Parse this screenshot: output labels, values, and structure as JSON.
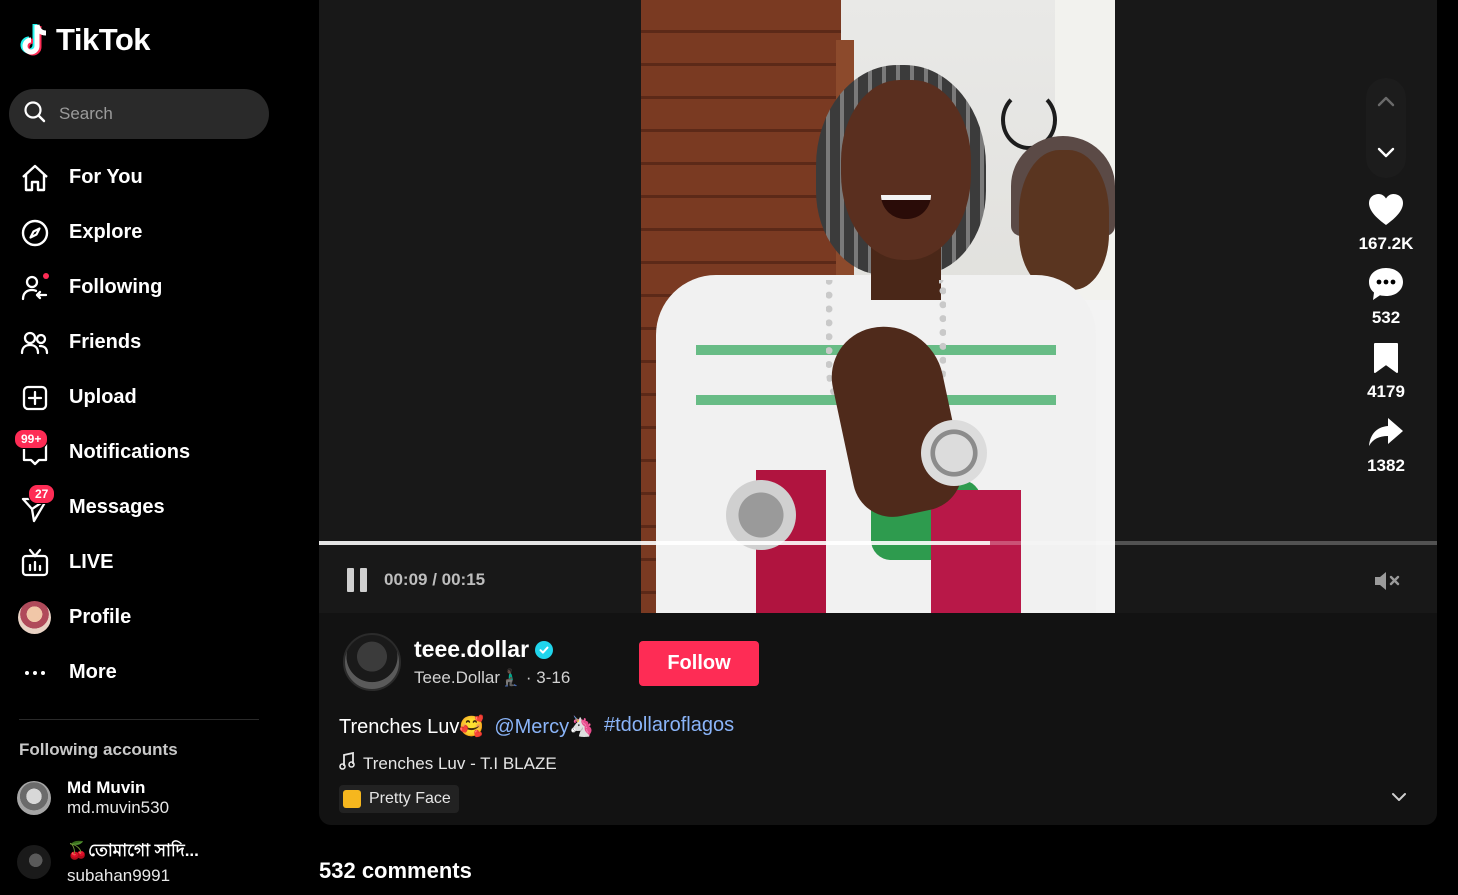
{
  "app": {
    "logo_text": "TikTok"
  },
  "search": {
    "placeholder": "Search"
  },
  "nav": {
    "items": [
      {
        "label": "For You",
        "icon": "home-icon"
      },
      {
        "label": "Explore",
        "icon": "compass-icon"
      },
      {
        "label": "Following",
        "icon": "following-icon"
      },
      {
        "label": "Friends",
        "icon": "friends-icon"
      },
      {
        "label": "Upload",
        "icon": "upload-icon"
      },
      {
        "label": "Notifications",
        "icon": "inbox-icon",
        "badge": "99+"
      },
      {
        "label": "Messages",
        "icon": "send-icon",
        "badge": "27"
      },
      {
        "label": "LIVE",
        "icon": "live-icon"
      },
      {
        "label": "Profile",
        "icon": "avatar"
      },
      {
        "label": "More",
        "icon": "more-icon"
      }
    ]
  },
  "following_accounts": {
    "title": "Following accounts",
    "accounts": [
      {
        "name": "Md Muvin",
        "username": "md.muvin530"
      },
      {
        "name": "🍒তোমাগো সাদি...",
        "username": "subahan9991"
      }
    ]
  },
  "player": {
    "time": "00:09 / 00:15",
    "progress_fraction": 0.6,
    "muted": true
  },
  "actions": {
    "likes": "167.2K",
    "comments": "532",
    "saves": "4179",
    "shares": "1382"
  },
  "video": {
    "creator_handle": "teee.dollar",
    "creator_sub": "Teee.Dollar🧎🏿‍♂️ · 3-16",
    "follow_label": "Follow",
    "caption_text": "Trenches Luv🥰",
    "caption_mention": "@Mercy🦄",
    "caption_hashtag": "#tdollaroflagos",
    "music": "Trenches Luv - T.I BLAZE",
    "effect": "Pretty Face"
  },
  "comments": {
    "title": "532 comments"
  },
  "colors": {
    "accent": "#fe2c55",
    "link": "#8ab4f8",
    "verified": "#20d5ec",
    "background": "#000000"
  }
}
